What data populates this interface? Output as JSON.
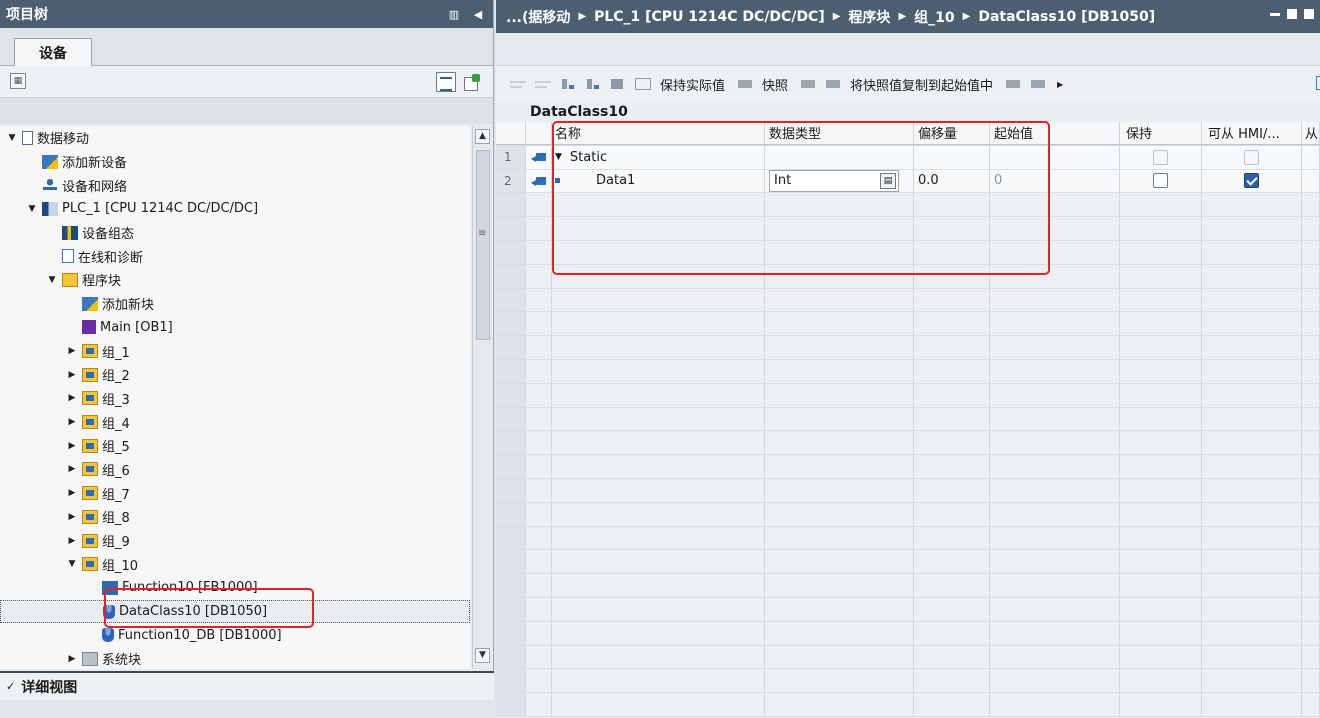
{
  "left": {
    "title": "项目树",
    "tab_label": "设备",
    "detail_view_label": "详细视图",
    "tree": [
      {
        "indent": 0,
        "twisty": "down",
        "icon": "page-icon",
        "label": "数据移动"
      },
      {
        "indent": 1,
        "twisty": "",
        "icon": "add-new-device-icon",
        "label": "添加新设备"
      },
      {
        "indent": 1,
        "twisty": "",
        "icon": "network-icon",
        "label": "设备和网络"
      },
      {
        "indent": 1,
        "twisty": "down",
        "icon": "plc-icon",
        "label": "PLC_1 [CPU 1214C DC/DC/DC]"
      },
      {
        "indent": 2,
        "twisty": "",
        "icon": "device-config-icon",
        "label": "设备组态"
      },
      {
        "indent": 2,
        "twisty": "",
        "icon": "online-diagnostics-icon",
        "label": "在线和诊断"
      },
      {
        "indent": 2,
        "twisty": "down",
        "icon": "program-blocks-folder-icon",
        "label": "程序块"
      },
      {
        "indent": 3,
        "twisty": "",
        "icon": "add-new-block-icon",
        "label": "添加新块"
      },
      {
        "indent": 3,
        "twisty": "",
        "icon": "ob-block-icon",
        "label": "Main [OB1]"
      },
      {
        "indent": 3,
        "twisty": "right",
        "icon": "group-folder-icon",
        "label": "组_1"
      },
      {
        "indent": 3,
        "twisty": "right",
        "icon": "group-folder-icon",
        "label": "组_2"
      },
      {
        "indent": 3,
        "twisty": "right",
        "icon": "group-folder-icon",
        "label": "组_3"
      },
      {
        "indent": 3,
        "twisty": "right",
        "icon": "group-folder-icon",
        "label": "组_4"
      },
      {
        "indent": 3,
        "twisty": "right",
        "icon": "group-folder-icon",
        "label": "组_5"
      },
      {
        "indent": 3,
        "twisty": "right",
        "icon": "group-folder-icon",
        "label": "组_6"
      },
      {
        "indent": 3,
        "twisty": "right",
        "icon": "group-folder-icon",
        "label": "组_7"
      },
      {
        "indent": 3,
        "twisty": "right",
        "icon": "group-folder-icon",
        "label": "组_8"
      },
      {
        "indent": 3,
        "twisty": "right",
        "icon": "group-folder-icon",
        "label": "组_9"
      },
      {
        "indent": 3,
        "twisty": "down",
        "icon": "group-folder-icon",
        "label": "组_10"
      },
      {
        "indent": 4,
        "twisty": "",
        "icon": "fb-block-icon",
        "label": "Function10 [FB1000]"
      },
      {
        "indent": 4,
        "twisty": "",
        "icon": "db-block-icon",
        "label": "DataClass10 [DB1050]",
        "selected": true
      },
      {
        "indent": 4,
        "twisty": "",
        "icon": "db-block-icon",
        "label": "Function10_DB [DB1000]"
      },
      {
        "indent": 3,
        "twisty": "right",
        "icon": "system-blocks-folder-icon",
        "label": "系统块"
      }
    ]
  },
  "right": {
    "breadcrumb": [
      "...(据移动",
      "PLC_1 [CPU 1214C DC/DC/DC]",
      "程序块",
      "组_10",
      "DataClass10 [DB1050]"
    ],
    "toolbar": {
      "keep_actual_values": "保持实际值",
      "snapshot": "快照",
      "copy_snapshot_to_start": "将快照值复制到起始值中"
    },
    "db_title": "DataClass10",
    "columns": {
      "name": "名称",
      "data_type": "数据类型",
      "offset": "偏移量",
      "start_value": "起始值",
      "retain": "保持",
      "hmi": "可从 HMI/...",
      "more": "从"
    },
    "rows": [
      {
        "num": "1",
        "name": "Static",
        "expand": "down",
        "type": "",
        "offset": "",
        "start": "",
        "retain": "dim",
        "hmi": "dim"
      },
      {
        "num": "2",
        "name": "Data1",
        "expand": "",
        "type": "Int",
        "offset": "0.0",
        "start": "0",
        "retain": "off",
        "hmi": "on"
      }
    ]
  }
}
